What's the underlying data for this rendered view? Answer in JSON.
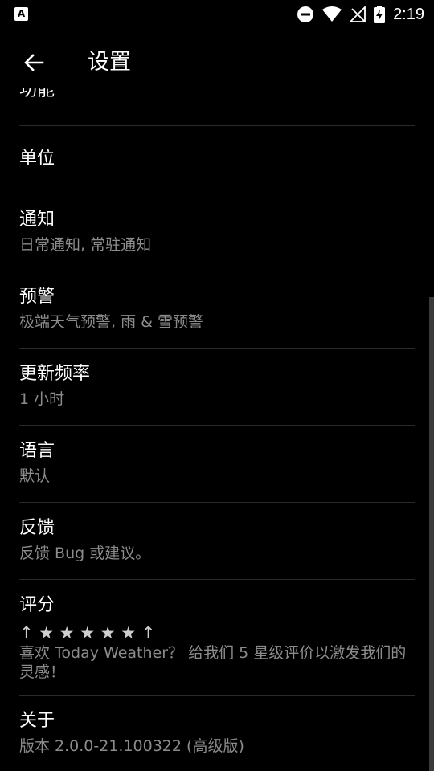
{
  "status_bar": {
    "app_badge": "A",
    "time": "2:19"
  },
  "app_bar": {
    "title": "设置"
  },
  "list": {
    "partial_item_title": "功能",
    "items": [
      {
        "title": "单位",
        "subtitle": ""
      },
      {
        "title": "通知",
        "subtitle": "日常通知, 常驻通知"
      },
      {
        "title": "预警",
        "subtitle": "极端天气预警, 雨 & 雪预警"
      },
      {
        "title": "更新频率",
        "subtitle": "1 小时"
      },
      {
        "title": "语言",
        "subtitle": "默认"
      },
      {
        "title": "反馈",
        "subtitle": "反馈 Bug 或建议。"
      },
      {
        "title": "评分",
        "stars": "↑ ★ ★ ★ ★ ★ ↑",
        "subtitle": "喜欢 Today Weather？ 给我们 5 星级评价以激发我们的灵感！"
      },
      {
        "title": "关于",
        "subtitle": "版本 2.0.0-21.100322 (高级版)"
      }
    ]
  },
  "colors": {
    "background": "#000000",
    "text_primary": "#ffffff",
    "text_secondary": "#8c8c8c",
    "divider": "#2a2a2a"
  }
}
